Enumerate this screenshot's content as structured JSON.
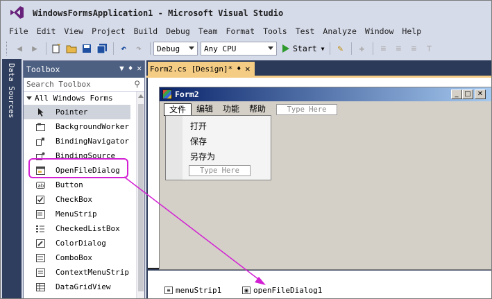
{
  "window": {
    "title": "WindowsFormsApplication1 - Microsoft Visual Studio"
  },
  "menu": [
    "File",
    "Edit",
    "View",
    "Project",
    "Build",
    "Debug",
    "Team",
    "Format",
    "Tools",
    "Test",
    "Analyze",
    "Window",
    "Help"
  ],
  "toolbar": {
    "config": "Debug",
    "platform": "Any CPU",
    "start_label": "Start"
  },
  "side_tab": {
    "label": "Data Sources"
  },
  "toolbox": {
    "title": "Toolbox",
    "search_placeholder": "Search Toolbox",
    "group": "All Windows Forms",
    "items": [
      {
        "label": "Pointer",
        "icon": "pointer-icon"
      },
      {
        "label": "BackgroundWorker",
        "icon": "background-worker-icon"
      },
      {
        "label": "BindingNavigator",
        "icon": "binding-navigator-icon"
      },
      {
        "label": "BindingSource",
        "icon": "binding-source-icon"
      },
      {
        "label": "OpenFileDialog",
        "icon": "open-file-dialog-icon"
      },
      {
        "label": "Button",
        "icon": "button-icon"
      },
      {
        "label": "CheckBox",
        "icon": "checkbox-icon"
      },
      {
        "label": "MenuStrip",
        "icon": "menustrip-icon"
      },
      {
        "label": "CheckedListBox",
        "icon": "checked-listbox-icon"
      },
      {
        "label": "ColorDialog",
        "icon": "color-dialog-icon"
      },
      {
        "label": "ComboBox",
        "icon": "combobox-icon"
      },
      {
        "label": "ContextMenuStrip",
        "icon": "context-menustrip-icon"
      },
      {
        "label": "DataGridView",
        "icon": "datagridview-icon"
      }
    ]
  },
  "document_tab": {
    "label": "Form2.cs [Design]*"
  },
  "form": {
    "title": "Form2",
    "menu": [
      "文件",
      "编辑",
      "功能",
      "帮助"
    ],
    "menu_type_here": "Type Here",
    "dropdown": {
      "items": [
        "打开",
        "保存",
        "另存为"
      ],
      "type_here": "Type Here"
    }
  },
  "tray": {
    "items": [
      "menuStrip1",
      "openFileDialog1"
    ]
  },
  "colors": {
    "highlight": "#d31fd3",
    "tab_active": "#f5cc84",
    "panel_header": "#4d6082"
  }
}
